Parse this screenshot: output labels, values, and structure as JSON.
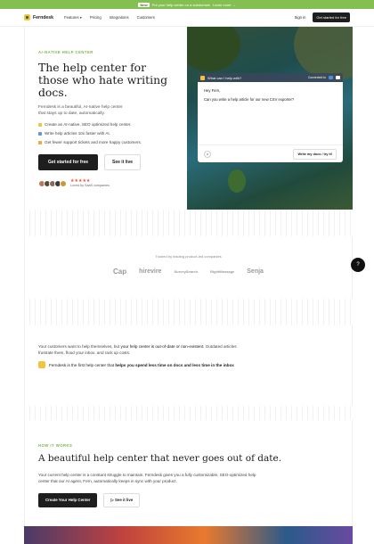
{
  "banner": {
    "badge": "New",
    "text": "Put your help center on a subdomain",
    "link": "Learn more →"
  },
  "nav": {
    "brand": "Ferndesk",
    "links": [
      "Features ▾",
      "Pricing",
      "Integrations",
      "Customers"
    ],
    "signin": "Sign in",
    "cta": "Get started for free"
  },
  "hero": {
    "eyebrow": "AI-NATIVE HELP CENTER",
    "title": "The help center for those who hate writing docs.",
    "subtitle": "Ferndesk is a beautiful, AI-native help center that stays up to date, automatically.",
    "features": [
      "Create an AI-native, SEO optimized help center.",
      "Write help articles 10x faster with AI.",
      "Get fewer support tickets and more happy customers."
    ],
    "cta_primary": "Get started for free",
    "cta_secondary": "See it live",
    "stars": "★★★★★",
    "loved": "Loved by SaaS companies",
    "colors": {
      "accent": "#7fb24a",
      "dark": "#1e1e1e",
      "star": "#e8513e"
    }
  },
  "chat": {
    "header": "What can I help with?",
    "connected": "Connected to",
    "greeting": "Hey Fern,",
    "message": "Can you write a help article for our new CSV exporter?",
    "write_button": "Write my docs / try it!"
  },
  "trusted": {
    "label": "Trusted by leading product-led companies",
    "logos": [
      "Cap",
      "hirevire",
      "SurveySearch",
      "RightMessage",
      "Senja"
    ]
  },
  "pain": {
    "text_1": "Your customers want to help themselves, but ",
    "text_bold": "your help center is out-of-date or non-existent.",
    "text_2": " Outdated articles frustrate them, flood your inbox, and rack up costs.",
    "first_1": "Ferndesk is the first help center that ",
    "first_bold": "helps you spend less time on docs and less time in the inbox"
  },
  "how": {
    "eyebrow": "HOW IT WORKS",
    "title": "A beautiful help center that never goes out of date.",
    "subtitle": "Your current help center is a constant struggle to maintain. Ferndesk gives you a fully customizable, SEO-optimized help center that our AI agent, Fern, automatically keeps in sync with your product.",
    "cta_primary": "Create Your Help Center",
    "cta_secondary": "See it live"
  },
  "help_button": "?"
}
